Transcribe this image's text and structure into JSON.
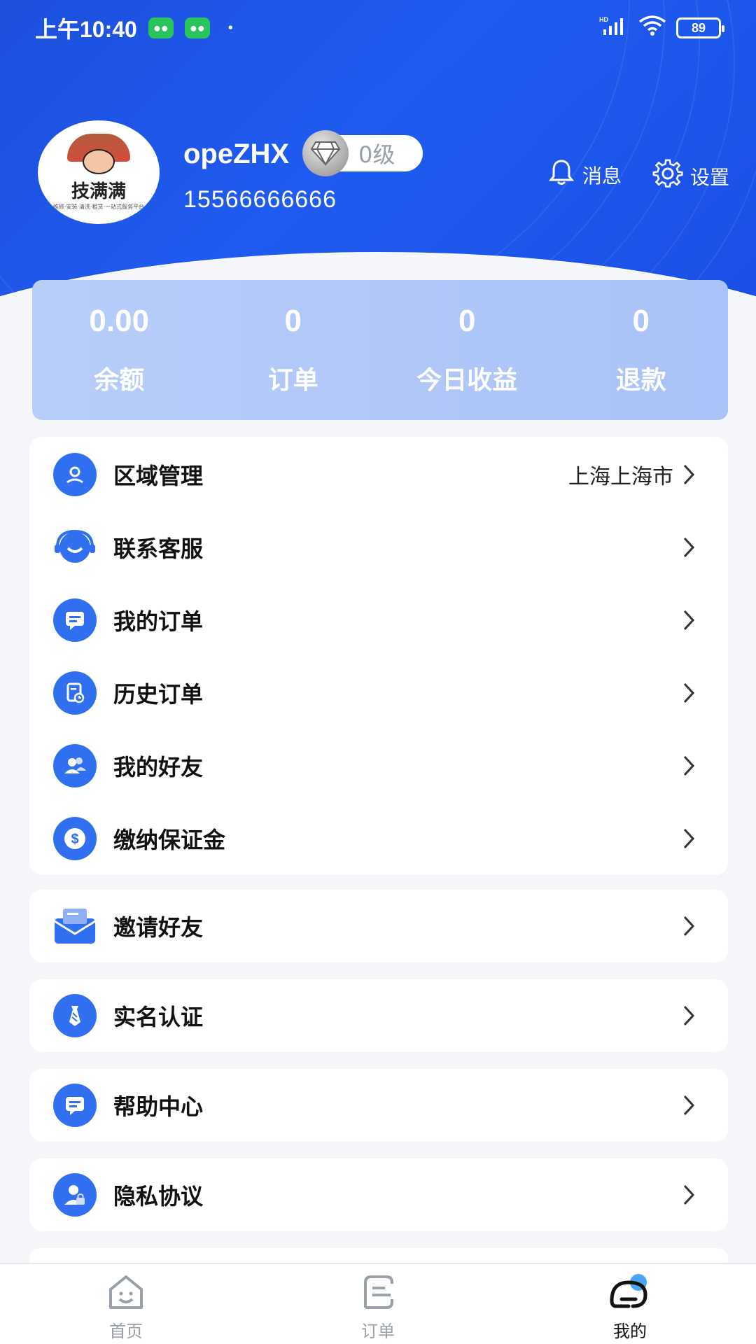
{
  "status_bar": {
    "time": "上午10:40",
    "signal_label": "HD",
    "battery": "89"
  },
  "profile": {
    "logo_text": "技满满",
    "logo_subtext": "维修·安装·清洗·租赁·一站式服务平台",
    "username": "opeZHX",
    "level": "0级",
    "phone": "15566666666",
    "messages_label": "消息",
    "settings_label": "设置"
  },
  "stats": [
    {
      "value": "0.00",
      "label": "余额"
    },
    {
      "value": "0",
      "label": "订单"
    },
    {
      "value": "0",
      "label": "今日收益"
    },
    {
      "value": "0",
      "label": "退款"
    }
  ],
  "menu_group": [
    {
      "label": "区域管理",
      "value": "上海上海市",
      "icon": "location-icon"
    },
    {
      "label": "联系客服",
      "value": "",
      "icon": "headset-icon"
    },
    {
      "label": "我的订单",
      "value": "",
      "icon": "chat-list-icon"
    },
    {
      "label": "历史订单",
      "value": "",
      "icon": "document-clock-icon"
    },
    {
      "label": "我的好友",
      "value": "",
      "icon": "friends-icon"
    },
    {
      "label": "缴纳保证金",
      "value": "",
      "icon": "dollar-icon"
    }
  ],
  "single_items": [
    {
      "label": "邀请好友",
      "icon": "envelope-icon"
    },
    {
      "label": "实名认证",
      "icon": "tie-icon"
    },
    {
      "label": "帮助中心",
      "icon": "help-chat-icon"
    },
    {
      "label": "隐私协议",
      "icon": "user-lock-icon"
    }
  ],
  "tabs": [
    {
      "label": "首页",
      "icon": "home-icon",
      "active": false
    },
    {
      "label": "订单",
      "icon": "orders-icon",
      "active": false
    },
    {
      "label": "我的",
      "icon": "mine-icon",
      "active": true
    }
  ],
  "colors": {
    "primary": "#1f5bf0",
    "icon_bg": "#2f6ff0",
    "stats_bg": "#b3c9f8"
  }
}
